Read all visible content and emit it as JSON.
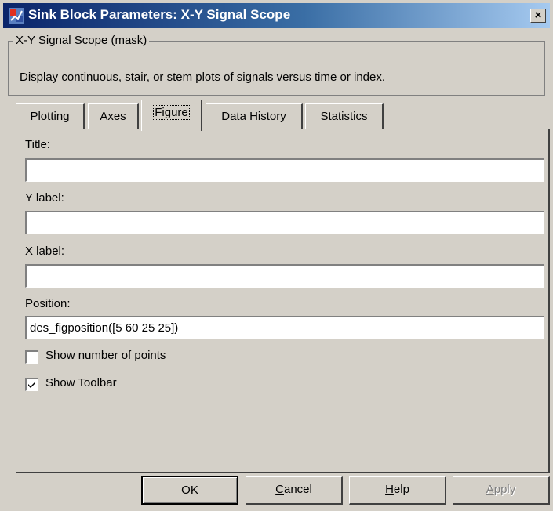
{
  "window": {
    "title": "Sink Block Parameters: X-Y Signal Scope",
    "close_glyph": "×"
  },
  "mask": {
    "legend": "X-Y Signal Scope (mask)",
    "description": "Display continuous, stair, or stem plots of signals versus time or index."
  },
  "tabs": [
    {
      "label": "Plotting",
      "active": false
    },
    {
      "label": "Axes",
      "active": false
    },
    {
      "label": "Figure",
      "active": true
    },
    {
      "label": "Data History",
      "active": false
    },
    {
      "label": "Statistics",
      "active": false
    }
  ],
  "fields": {
    "title": {
      "label": "Title:",
      "value": ""
    },
    "ylabel": {
      "label": "Y label:",
      "value": ""
    },
    "xlabel": {
      "label": "X label:",
      "value": ""
    },
    "position": {
      "label": "Position:",
      "value": "des_figposition([5 60 25 25])"
    }
  },
  "checkboxes": {
    "show_points": {
      "label": "Show number of points",
      "checked": false
    },
    "show_toolbar": {
      "label": "Show Toolbar",
      "checked": true
    }
  },
  "buttons": {
    "ok": {
      "mnemonic": "O",
      "rest": "K"
    },
    "cancel": {
      "mnemonic": "C",
      "rest": "ancel"
    },
    "help": {
      "mnemonic": "H",
      "rest": "elp"
    },
    "apply": {
      "mnemonic": "A",
      "rest": "pply",
      "disabled": true
    }
  },
  "colors": {
    "titlebar_start": "#0a246a",
    "titlebar_end": "#a6caf0",
    "face": "#d4d0c8"
  },
  "icons": {
    "app": "simulink-block-icon",
    "check": "checkmark-icon"
  }
}
